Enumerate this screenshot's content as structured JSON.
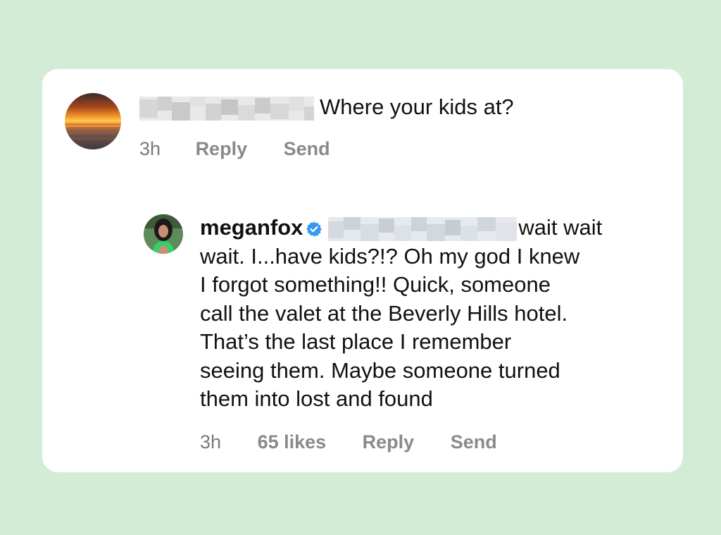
{
  "comment": {
    "text": "Where your kids at?",
    "time": "3h",
    "reply_label": "Reply",
    "send_label": "Send"
  },
  "reply": {
    "username": "meganfox",
    "lines": [
      "wait wait",
      "wait. I...have kids?!? Oh my god I knew",
      "I forgot something!! Quick, someone",
      "call the valet at the Beverly Hills hotel.",
      "That’s the last place I remember",
      "seeing them. Maybe someone turned",
      "them into lost and found"
    ],
    "time": "3h",
    "likes": "65 likes",
    "reply_label": "Reply",
    "send_label": "Send"
  },
  "icons": {
    "verified": "verified-badge-icon"
  },
  "colors": {
    "page_background": "#d2ecd5",
    "card_background": "#ffffff",
    "verified_blue": "#3897f0",
    "meta_gray": "#8a8a8a"
  }
}
